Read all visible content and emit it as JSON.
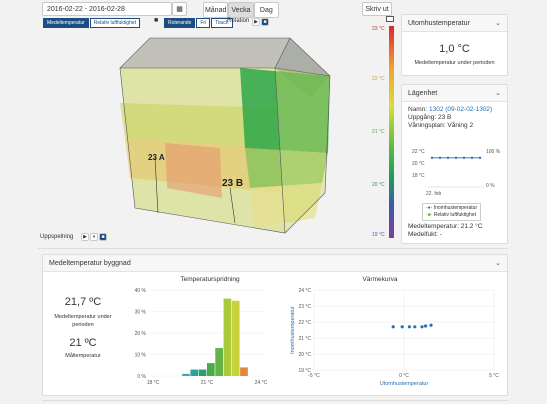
{
  "toolbar": {
    "date_range": "2016-02-22 - 2016-02-28",
    "period_buttons": [
      "Månad",
      "Vecka",
      "Dag"
    ],
    "active_period": "Vecka",
    "print_label": "Skriv ut",
    "mode_tags": [
      "Medeltemperatur",
      "Relativ luftfuktighet"
    ],
    "view_tags": [
      "Roterande",
      "Fri",
      "Touch"
    ],
    "rotation_label": "Rotation"
  },
  "model": {
    "label_a": "23 A",
    "label_b": "23 B",
    "playback_label": "Uppspelning"
  },
  "color_scale": {
    "labels": [
      "23 °C",
      "22 °C",
      "21 °C",
      "20 °C",
      "19 °C"
    ],
    "colors": [
      "#d9272e",
      "#f0a330",
      "#d8dc3c",
      "#69bd45",
      "#1f9d5a",
      "#3b5ba7",
      "#7b3f98"
    ]
  },
  "outdoor": {
    "title": "Utomhustemperatur",
    "value": "1,0 °C",
    "caption": "Medeltemperatur under perioden"
  },
  "apartment": {
    "title": "Lägenhet",
    "name_label": "Namn:",
    "name_value": "1302 (09-02-02-1302)",
    "entrance_label": "Uppgång:",
    "entrance_value": "23 B",
    "floor_label": "Våningsplan:",
    "floor_value": "Våning 2",
    "mini_y_left": [
      "22 °C",
      "20 °C",
      "18 °C"
    ],
    "mini_y_right": [
      "100 %",
      "0 %"
    ],
    "mini_x": "22. feb",
    "mini_series_temp": [
      21.2,
      21.2,
      21.2,
      21.2,
      21.2,
      21.2,
      21.2
    ],
    "legend_temp": "Inomhustemperatur",
    "legend_hum": "Relativ luftfuktighet",
    "avg_temp_label": "Medeltemperatur:",
    "avg_temp_value": "21.2 °C",
    "avg_hum_label": "Medelfukt:",
    "avg_hum_value": "-"
  },
  "building": {
    "title": "Medeltemperatur byggnad",
    "avg_value": "21,7 ºC",
    "avg_caption": "Medeltemperatur under perioden",
    "target_value": "21 ºC",
    "target_caption": "Måltemperatur"
  },
  "chart_data": [
    {
      "type": "bar",
      "title": "Temperaturspridning",
      "x_ticks": [
        "18 °C",
        "21 °C",
        "24 °C"
      ],
      "y_ticks": [
        "40 %",
        "30 %",
        "20 %",
        "10 %",
        "0 %"
      ],
      "ylim": [
        0,
        40
      ],
      "categories": [
        "18.5",
        "19.0",
        "19.5",
        "20.0",
        "20.5",
        "21.0",
        "21.5",
        "22.0",
        "22.5",
        "23.0"
      ],
      "values": [
        0,
        0,
        1,
        3,
        3,
        6,
        13,
        36,
        35,
        4
      ],
      "colors": [
        "#3fa6c2",
        "#3fa6c2",
        "#3fa6c2",
        "#29a3a0",
        "#2e9e6a",
        "#4aaa47",
        "#63b346",
        "#a9c93d",
        "#c8d23b",
        "#e1883a"
      ]
    },
    {
      "type": "scatter",
      "title": "Värmekurva",
      "xlabel": "Utomhustemperatur",
      "ylabel": "Inomhustemperatur",
      "x_ticks": [
        "-5 °C",
        "0 °C",
        "5 °C"
      ],
      "y_ticks": [
        "24 °C",
        "23 °C",
        "22 °C",
        "21 °C",
        "20 °C",
        "19 °C"
      ],
      "xlim": [
        -5,
        5
      ],
      "ylim": [
        19,
        24
      ],
      "x": [
        -0.6,
        -0.1,
        0.3,
        0.6,
        1.0,
        1.2,
        1.5
      ],
      "y": [
        21.7,
        21.7,
        21.7,
        21.7,
        21.7,
        21.75,
        21.8
      ]
    }
  ]
}
